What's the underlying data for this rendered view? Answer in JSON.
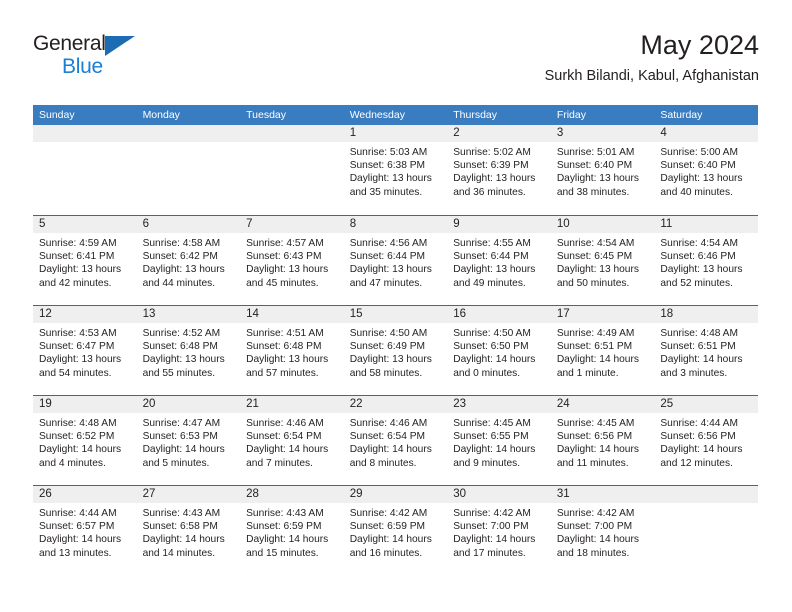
{
  "brand": {
    "name_top": "General",
    "name_bottom": "Blue",
    "color_dark": "#231f20",
    "color_blue": "#1b7fd4",
    "triangle_color": "#1b6cb3"
  },
  "header": {
    "title": "May 2024",
    "subtitle": "Surkh Bilandi, Kabul, Afghanistan"
  },
  "theme": {
    "header_bg": "#3a7cc0",
    "row_rule": "#2e6da4",
    "date_strip_bg": "#efefef",
    "text": "#231f20"
  },
  "weekdays": [
    "Sunday",
    "Monday",
    "Tuesday",
    "Wednesday",
    "Thursday",
    "Friday",
    "Saturday"
  ],
  "labels": {
    "sunrise_prefix": "Sunrise:",
    "sunset_prefix": "Sunset:",
    "daylight_prefix": "Daylight:"
  },
  "weeks": [
    [
      {
        "day": "",
        "empty": true
      },
      {
        "day": "",
        "empty": true
      },
      {
        "day": "",
        "empty": true
      },
      {
        "day": "1",
        "sunrise": "Sunrise: 5:03 AM",
        "sunset": "Sunset: 6:38 PM",
        "daylight1": "Daylight: 13 hours",
        "daylight2": "and 35 minutes."
      },
      {
        "day": "2",
        "sunrise": "Sunrise: 5:02 AM",
        "sunset": "Sunset: 6:39 PM",
        "daylight1": "Daylight: 13 hours",
        "daylight2": "and 36 minutes."
      },
      {
        "day": "3",
        "sunrise": "Sunrise: 5:01 AM",
        "sunset": "Sunset: 6:40 PM",
        "daylight1": "Daylight: 13 hours",
        "daylight2": "and 38 minutes."
      },
      {
        "day": "4",
        "sunrise": "Sunrise: 5:00 AM",
        "sunset": "Sunset: 6:40 PM",
        "daylight1": "Daylight: 13 hours",
        "daylight2": "and 40 minutes."
      }
    ],
    [
      {
        "day": "5",
        "sunrise": "Sunrise: 4:59 AM",
        "sunset": "Sunset: 6:41 PM",
        "daylight1": "Daylight: 13 hours",
        "daylight2": "and 42 minutes."
      },
      {
        "day": "6",
        "sunrise": "Sunrise: 4:58 AM",
        "sunset": "Sunset: 6:42 PM",
        "daylight1": "Daylight: 13 hours",
        "daylight2": "and 44 minutes."
      },
      {
        "day": "7",
        "sunrise": "Sunrise: 4:57 AM",
        "sunset": "Sunset: 6:43 PM",
        "daylight1": "Daylight: 13 hours",
        "daylight2": "and 45 minutes."
      },
      {
        "day": "8",
        "sunrise": "Sunrise: 4:56 AM",
        "sunset": "Sunset: 6:44 PM",
        "daylight1": "Daylight: 13 hours",
        "daylight2": "and 47 minutes."
      },
      {
        "day": "9",
        "sunrise": "Sunrise: 4:55 AM",
        "sunset": "Sunset: 6:44 PM",
        "daylight1": "Daylight: 13 hours",
        "daylight2": "and 49 minutes."
      },
      {
        "day": "10",
        "sunrise": "Sunrise: 4:54 AM",
        "sunset": "Sunset: 6:45 PM",
        "daylight1": "Daylight: 13 hours",
        "daylight2": "and 50 minutes."
      },
      {
        "day": "11",
        "sunrise": "Sunrise: 4:54 AM",
        "sunset": "Sunset: 6:46 PM",
        "daylight1": "Daylight: 13 hours",
        "daylight2": "and 52 minutes."
      }
    ],
    [
      {
        "day": "12",
        "sunrise": "Sunrise: 4:53 AM",
        "sunset": "Sunset: 6:47 PM",
        "daylight1": "Daylight: 13 hours",
        "daylight2": "and 54 minutes."
      },
      {
        "day": "13",
        "sunrise": "Sunrise: 4:52 AM",
        "sunset": "Sunset: 6:48 PM",
        "daylight1": "Daylight: 13 hours",
        "daylight2": "and 55 minutes."
      },
      {
        "day": "14",
        "sunrise": "Sunrise: 4:51 AM",
        "sunset": "Sunset: 6:48 PM",
        "daylight1": "Daylight: 13 hours",
        "daylight2": "and 57 minutes."
      },
      {
        "day": "15",
        "sunrise": "Sunrise: 4:50 AM",
        "sunset": "Sunset: 6:49 PM",
        "daylight1": "Daylight: 13 hours",
        "daylight2": "and 58 minutes."
      },
      {
        "day": "16",
        "sunrise": "Sunrise: 4:50 AM",
        "sunset": "Sunset: 6:50 PM",
        "daylight1": "Daylight: 14 hours",
        "daylight2": "and 0 minutes."
      },
      {
        "day": "17",
        "sunrise": "Sunrise: 4:49 AM",
        "sunset": "Sunset: 6:51 PM",
        "daylight1": "Daylight: 14 hours",
        "daylight2": "and 1 minute."
      },
      {
        "day": "18",
        "sunrise": "Sunrise: 4:48 AM",
        "sunset": "Sunset: 6:51 PM",
        "daylight1": "Daylight: 14 hours",
        "daylight2": "and 3 minutes."
      }
    ],
    [
      {
        "day": "19",
        "sunrise": "Sunrise: 4:48 AM",
        "sunset": "Sunset: 6:52 PM",
        "daylight1": "Daylight: 14 hours",
        "daylight2": "and 4 minutes."
      },
      {
        "day": "20",
        "sunrise": "Sunrise: 4:47 AM",
        "sunset": "Sunset: 6:53 PM",
        "daylight1": "Daylight: 14 hours",
        "daylight2": "and 5 minutes."
      },
      {
        "day": "21",
        "sunrise": "Sunrise: 4:46 AM",
        "sunset": "Sunset: 6:54 PM",
        "daylight1": "Daylight: 14 hours",
        "daylight2": "and 7 minutes."
      },
      {
        "day": "22",
        "sunrise": "Sunrise: 4:46 AM",
        "sunset": "Sunset: 6:54 PM",
        "daylight1": "Daylight: 14 hours",
        "daylight2": "and 8 minutes."
      },
      {
        "day": "23",
        "sunrise": "Sunrise: 4:45 AM",
        "sunset": "Sunset: 6:55 PM",
        "daylight1": "Daylight: 14 hours",
        "daylight2": "and 9 minutes."
      },
      {
        "day": "24",
        "sunrise": "Sunrise: 4:45 AM",
        "sunset": "Sunset: 6:56 PM",
        "daylight1": "Daylight: 14 hours",
        "daylight2": "and 11 minutes."
      },
      {
        "day": "25",
        "sunrise": "Sunrise: 4:44 AM",
        "sunset": "Sunset: 6:56 PM",
        "daylight1": "Daylight: 14 hours",
        "daylight2": "and 12 minutes."
      }
    ],
    [
      {
        "day": "26",
        "sunrise": "Sunrise: 4:44 AM",
        "sunset": "Sunset: 6:57 PM",
        "daylight1": "Daylight: 14 hours",
        "daylight2": "and 13 minutes."
      },
      {
        "day": "27",
        "sunrise": "Sunrise: 4:43 AM",
        "sunset": "Sunset: 6:58 PM",
        "daylight1": "Daylight: 14 hours",
        "daylight2": "and 14 minutes."
      },
      {
        "day": "28",
        "sunrise": "Sunrise: 4:43 AM",
        "sunset": "Sunset: 6:59 PM",
        "daylight1": "Daylight: 14 hours",
        "daylight2": "and 15 minutes."
      },
      {
        "day": "29",
        "sunrise": "Sunrise: 4:42 AM",
        "sunset": "Sunset: 6:59 PM",
        "daylight1": "Daylight: 14 hours",
        "daylight2": "and 16 minutes."
      },
      {
        "day": "30",
        "sunrise": "Sunrise: 4:42 AM",
        "sunset": "Sunset: 7:00 PM",
        "daylight1": "Daylight: 14 hours",
        "daylight2": "and 17 minutes."
      },
      {
        "day": "31",
        "sunrise": "Sunrise: 4:42 AM",
        "sunset": "Sunset: 7:00 PM",
        "daylight1": "Daylight: 14 hours",
        "daylight2": "and 18 minutes."
      },
      {
        "day": "",
        "empty": true
      }
    ]
  ]
}
